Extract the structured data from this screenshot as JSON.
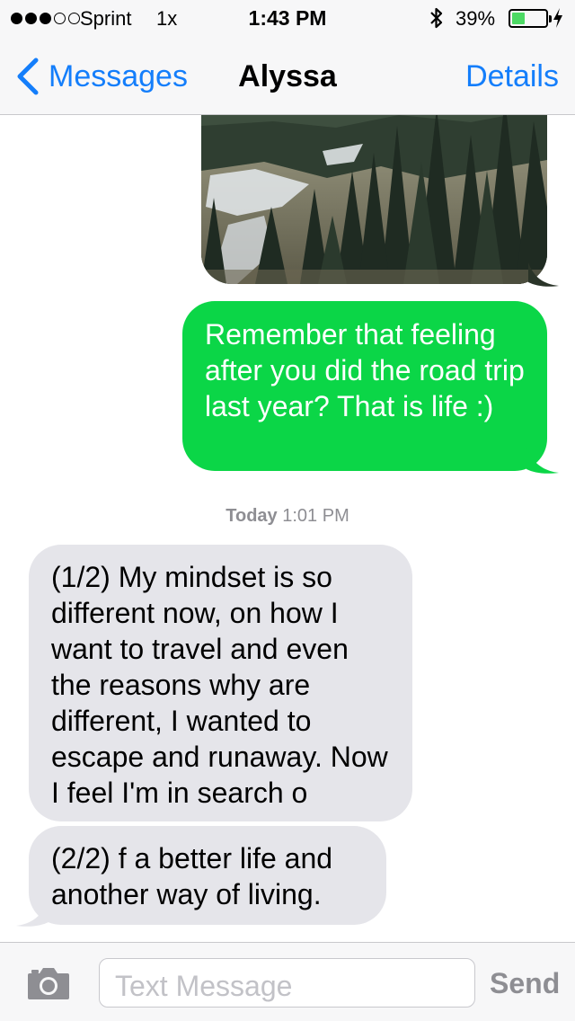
{
  "status_bar": {
    "carrier": "Sprint",
    "network": "1x",
    "time": "1:43 PM",
    "battery_percent": "39%",
    "battery_level": 0.39,
    "signal_bars_filled": 3,
    "signal_bars_total": 5,
    "battery_fill_color": "#4cd964",
    "icons": [
      "bluetooth-icon",
      "battery-icon",
      "charging-bolt-icon"
    ]
  },
  "nav": {
    "back_label": "Messages",
    "title": "Alyssa",
    "details_label": "Details",
    "accent_color": "#147efb"
  },
  "conversation": {
    "photo_icon": "landscape-photo",
    "sent_message": "Remember that feeling after you did the road trip last year? That is life :)",
    "sent_color": "#0bd647",
    "timestamp_day": "Today",
    "timestamp_time": "1:01 PM",
    "received_messages": [
      "(1/2) My mindset is so different now, on how I want to travel and even the reasons why are different, I wanted to escape and runaway. Now I feel I'm in search o",
      "(2/2) f a better life and another way of living."
    ],
    "received_color": "#e5e5ea"
  },
  "input_bar": {
    "camera_icon": "camera-icon",
    "placeholder": "Text Message",
    "send_label": "Send"
  }
}
